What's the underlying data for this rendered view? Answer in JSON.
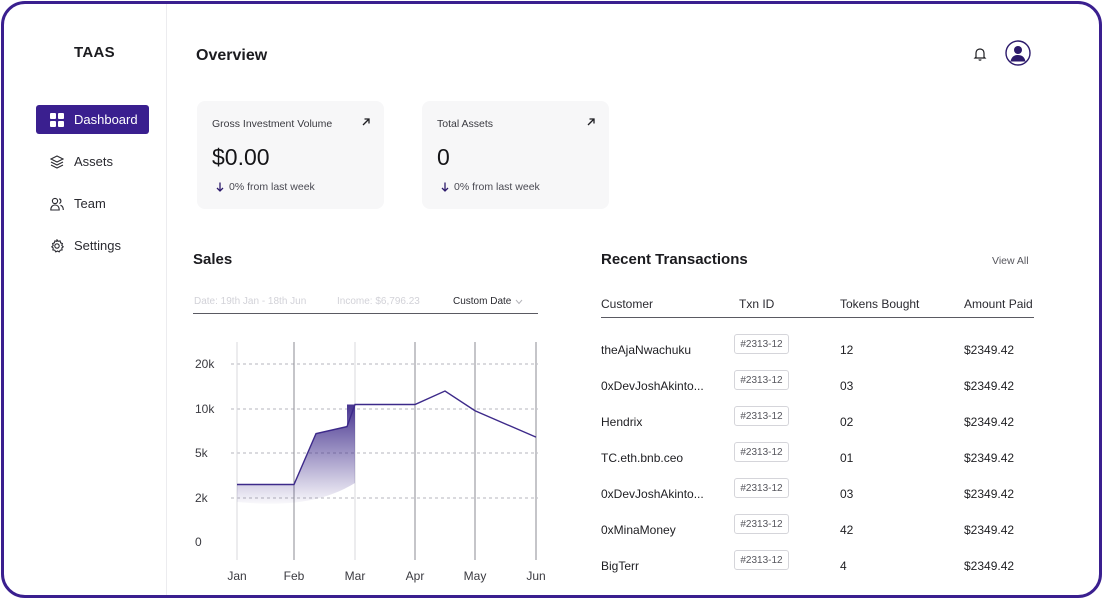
{
  "app": {
    "brand": "TAAS"
  },
  "sidebar": {
    "items": [
      {
        "label": "Dashboard",
        "icon": "grid-icon",
        "active": true
      },
      {
        "label": "Assets",
        "icon": "layers-icon",
        "active": false
      },
      {
        "label": "Team",
        "icon": "users-icon",
        "active": false
      },
      {
        "label": "Settings",
        "icon": "gear-icon",
        "active": false
      }
    ]
  },
  "header": {
    "title": "Overview",
    "icons": [
      "bell-icon",
      "user-avatar-icon"
    ]
  },
  "cards": [
    {
      "label": "Gross Investment Volume",
      "value": "$0.00",
      "change": "0% from last week"
    },
    {
      "label": "Total Assets",
      "value": "0",
      "change": "0% from last week"
    }
  ],
  "sales": {
    "title": "Sales",
    "filters": {
      "date": "Date: 19th Jan - 18th Jun",
      "income": "Income: $6,796.23",
      "custom": "Custom Date"
    }
  },
  "chart_data": {
    "type": "area",
    "categories": [
      "Jan",
      "Feb",
      "Mar",
      "Apr",
      "May",
      "Jun"
    ],
    "y_ticks": [
      "20k",
      "10k",
      "5k",
      "2k",
      "0"
    ],
    "x": [
      "Jan",
      "Feb",
      "Feb-Mar",
      "Feb-Mar",
      "Mar",
      "Apr",
      "Apr-May",
      "May",
      "Jun"
    ],
    "values": [
      2900,
      2900,
      7200,
      8000,
      11000,
      11000,
      14000,
      9800,
      6800
    ],
    "grid": true
  },
  "transactions": {
    "title": "Recent Transactions",
    "view_all": "View All",
    "columns": [
      "Customer",
      "Txn ID",
      "Tokens Bought",
      "Amount Paid"
    ],
    "rows": [
      {
        "customer": "theAjaNwachuku",
        "txn": "#2313-12",
        "tokens": "12",
        "amount": "$2349.42"
      },
      {
        "customer": "0xDevJoshAkinto...",
        "txn": "#2313-12",
        "tokens": "03",
        "amount": "$2349.42"
      },
      {
        "customer": "Hendrix",
        "txn": "#2313-12",
        "tokens": "02",
        "amount": "$2349.42"
      },
      {
        "customer": "TC.eth.bnb.ceo",
        "txn": "#2313-12",
        "tokens": "01",
        "amount": "$2349.42"
      },
      {
        "customer": "0xDevJoshAkinto...",
        "txn": "#2313-12",
        "tokens": "03",
        "amount": "$2349.42"
      },
      {
        "customer": "0xMinaMoney",
        "txn": "#2313-12",
        "tokens": "42",
        "amount": "$2349.42"
      },
      {
        "customer": "BigTerr",
        "txn": "#2313-12",
        "tokens": "4",
        "amount": "$2349.42"
      }
    ]
  },
  "colors": {
    "accent": "#3a1f8f",
    "frame": "#3a1f8f",
    "chart_line": "#3d2a8a"
  }
}
